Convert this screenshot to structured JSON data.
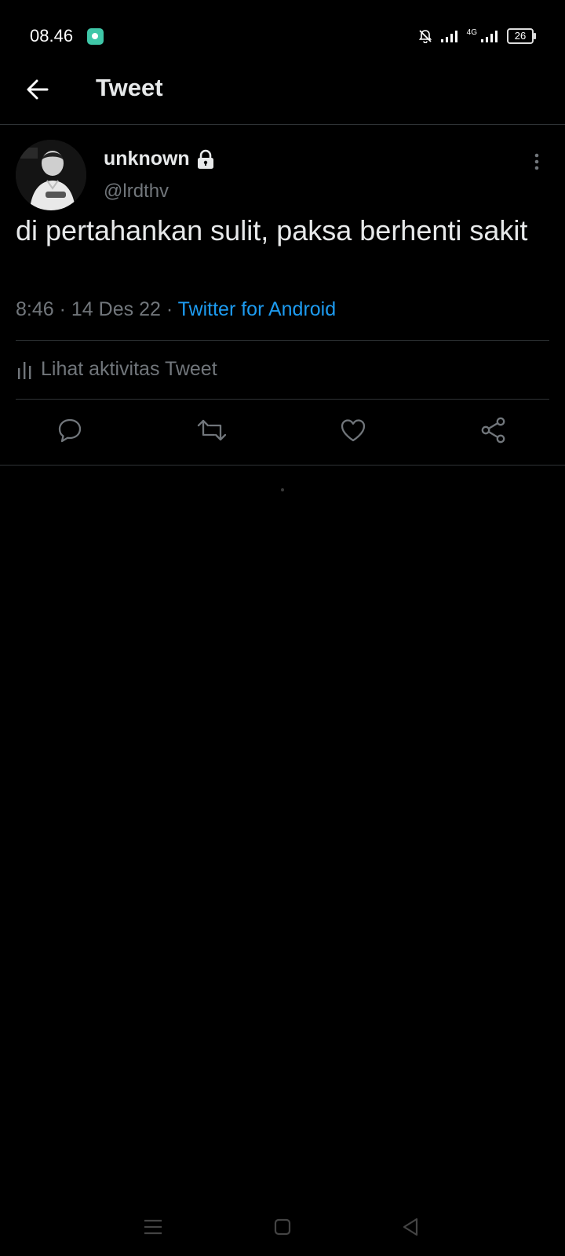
{
  "status_bar": {
    "time": "08.46",
    "network_label": "4G",
    "battery": "26"
  },
  "header": {
    "title": "Tweet"
  },
  "tweet": {
    "display_name": "unknown",
    "handle": "@lrdthv",
    "protected": true,
    "text": "di pertahankan sulit, paksa berhenti sakit",
    "time": "8:46",
    "date": "14 Des 22",
    "separator": "·",
    "source": "Twitter for Android",
    "activity_label": "Lihat aktivitas Tweet"
  },
  "actions": [
    "reply-icon",
    "retweet-icon",
    "like-icon",
    "share-icon"
  ],
  "colors": {
    "background": "#000000",
    "text": "#e7e9ea",
    "secondary_text": "#71767b",
    "accent": "#1d9bf0",
    "divider": "#2f3336"
  }
}
